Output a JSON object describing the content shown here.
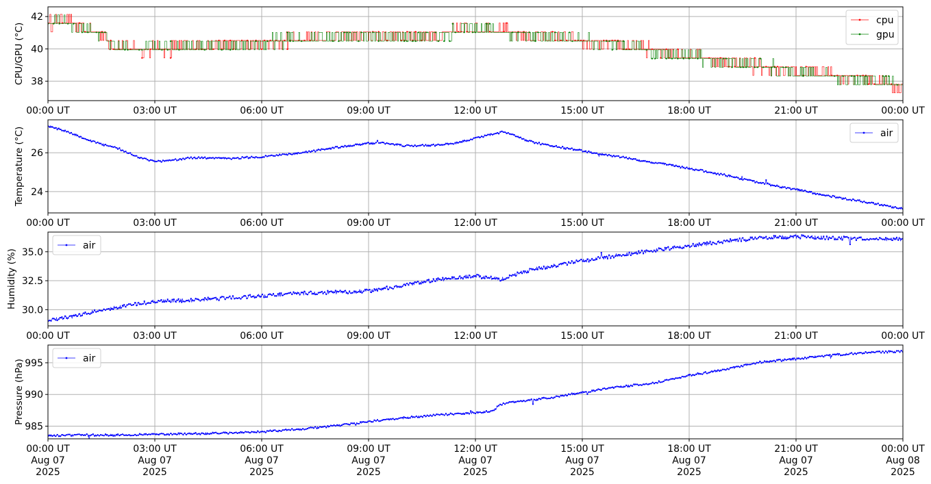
{
  "colors": {
    "cpu": "#ff0000",
    "gpu": "#008000",
    "air": "#0000ff",
    "grid": "#b0b0b0"
  },
  "x_ticks": {
    "times": [
      "00:00 UT",
      "03:00 UT",
      "06:00 UT",
      "09:00 UT",
      "12:00 UT",
      "15:00 UT",
      "18:00 UT",
      "21:00 UT",
      "00:00 UT"
    ],
    "dates": [
      "Aug 07",
      "Aug 07",
      "Aug 07",
      "Aug 07",
      "Aug 07",
      "Aug 07",
      "Aug 07",
      "Aug 07",
      "Aug 08"
    ],
    "years": [
      "2025",
      "2025",
      "2025",
      "2025",
      "2025",
      "2025",
      "2025",
      "2025",
      "2025"
    ]
  },
  "chart_data": [
    {
      "type": "line",
      "ylabel": "CPU/GPU (°C)",
      "xlim_hours": [
        0,
        24
      ],
      "ylim": [
        36.8,
        42.6
      ],
      "yticks": [
        38,
        40,
        42
      ],
      "ytick_labels": [
        "38",
        "40",
        "42"
      ],
      "grid": true,
      "legend": "top-right",
      "series": [
        {
          "name": "cpu",
          "x_hours": [
            0,
            0.5,
            1.0,
            1.6,
            1.8,
            2.5,
            3.5,
            5.0,
            7.0,
            9.0,
            11.0,
            11.9,
            12.9,
            13.5,
            14.0,
            15.0,
            16.0,
            17.5,
            18.5,
            19.5,
            21.0,
            23.0,
            24.0
          ],
          "values": [
            41.6,
            41.7,
            41.2,
            40.8,
            40.2,
            40.0,
            40.0,
            40.2,
            40.6,
            40.8,
            40.8,
            41.3,
            41.0,
            40.8,
            40.7,
            40.4,
            40.2,
            39.8,
            39.4,
            39.0,
            38.6,
            38.2,
            37.6
          ]
        },
        {
          "name": "gpu",
          "x_hours": [
            0,
            0.5,
            1.0,
            1.6,
            1.8,
            2.5,
            3.5,
            5.0,
            7.0,
            9.0,
            11.0,
            11.9,
            12.9,
            13.5,
            14.0,
            15.0,
            16.0,
            17.5,
            18.5,
            19.5,
            21.0,
            23.0,
            24.0
          ],
          "values": [
            41.8,
            41.6,
            41.3,
            40.9,
            40.1,
            40.0,
            40.1,
            40.3,
            40.6,
            40.8,
            40.8,
            41.4,
            41.0,
            40.8,
            40.7,
            40.5,
            40.2,
            39.7,
            39.4,
            39.1,
            38.6,
            38.1,
            37.8
          ]
        }
      ]
    },
    {
      "type": "line",
      "ylabel": "Temperature (°C)",
      "xlim_hours": [
        0,
        24
      ],
      "ylim": [
        22.9,
        27.7
      ],
      "yticks": [
        24,
        26
      ],
      "ytick_labels": [
        "24",
        "26"
      ],
      "grid": true,
      "legend": "top-right",
      "series": [
        {
          "name": "air",
          "x_hours": [
            0,
            0.5,
            1.0,
            1.5,
            2.0,
            2.5,
            3.0,
            3.5,
            4.0,
            5.0,
            6.0,
            7.0,
            8.0,
            9.0,
            9.5,
            10.0,
            11.0,
            11.5,
            12.0,
            12.5,
            12.8,
            13.0,
            13.5,
            14.0,
            15.0,
            16.0,
            17.0,
            18.0,
            19.0,
            20.0,
            21.0,
            22.0,
            23.0,
            24.0
          ],
          "values": [
            27.4,
            27.1,
            26.75,
            26.45,
            26.2,
            25.8,
            25.55,
            25.6,
            25.75,
            25.7,
            25.8,
            25.95,
            26.25,
            26.5,
            26.5,
            26.35,
            26.4,
            26.5,
            26.75,
            26.95,
            27.1,
            26.95,
            26.6,
            26.4,
            26.1,
            25.8,
            25.5,
            25.2,
            24.85,
            24.45,
            24.1,
            23.75,
            23.45,
            23.1
          ]
        }
      ]
    },
    {
      "type": "line",
      "ylabel": "Humidity (%)",
      "xlim_hours": [
        0,
        24
      ],
      "ylim": [
        28.6,
        36.7
      ],
      "yticks": [
        30.0,
        32.5,
        35.0
      ],
      "ytick_labels": [
        "30.0",
        "32.5",
        "35.0"
      ],
      "grid": true,
      "legend": "top-left",
      "series": [
        {
          "name": "air",
          "x_hours": [
            0,
            0.5,
            1.0,
            1.5,
            2.0,
            2.5,
            3.0,
            4.0,
            5.0,
            6.0,
            7.0,
            8.0,
            9.0,
            10.0,
            11.0,
            12.0,
            12.5,
            12.7,
            13.0,
            13.5,
            14.0,
            15.0,
            16.0,
            17.0,
            18.0,
            19.0,
            20.0,
            21.0,
            22.0,
            23.0,
            24.0
          ],
          "values": [
            29.1,
            29.3,
            29.6,
            30.0,
            30.2,
            30.5,
            30.7,
            30.8,
            31.0,
            31.2,
            31.4,
            31.5,
            31.6,
            32.1,
            32.6,
            32.9,
            32.7,
            32.6,
            32.9,
            33.4,
            33.7,
            34.2,
            34.7,
            35.1,
            35.5,
            35.9,
            36.2,
            36.3,
            36.2,
            36.1,
            36.1
          ]
        }
      ]
    },
    {
      "type": "line",
      "ylabel": "Pressure (hPa)",
      "xlim_hours": [
        0,
        24
      ],
      "ylim": [
        983.0,
        997.8
      ],
      "yticks": [
        985,
        990,
        995
      ],
      "ytick_labels": [
        "985",
        "990",
        "995"
      ],
      "grid": true,
      "legend": "top-left",
      "series": [
        {
          "name": "air",
          "x_hours": [
            0,
            1.0,
            2.0,
            3.0,
            4.0,
            5.0,
            6.0,
            7.0,
            8.0,
            9.0,
            10.0,
            11.0,
            12.0,
            12.5,
            12.65,
            13.0,
            14.0,
            15.0,
            16.0,
            17.0,
            18.0,
            19.0,
            20.0,
            21.0,
            22.0,
            23.0,
            24.0
          ],
          "values": [
            983.5,
            983.6,
            983.6,
            983.7,
            983.8,
            983.9,
            984.1,
            984.5,
            985.0,
            985.7,
            986.3,
            986.8,
            987.1,
            987.4,
            988.3,
            988.8,
            989.4,
            990.3,
            991.2,
            991.8,
            993.0,
            993.9,
            995.1,
            995.6,
            996.2,
            996.6,
            996.8
          ]
        }
      ]
    }
  ]
}
